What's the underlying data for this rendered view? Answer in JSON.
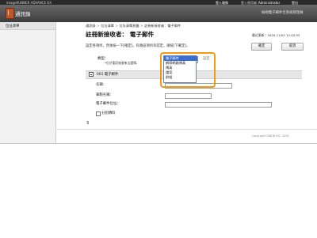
{
  "topbar": {
    "model_text": "imageRUNNER ADVANCE DX",
    "service_button": "登入服務",
    "user_label": "登入使用者：",
    "user_name": "Administrator",
    "logout_button": "登出"
  },
  "header": {
    "app_title": "通訊錄",
    "right_link": "檢視電子郵件至系統管理員"
  },
  "sidebar": {
    "items": [
      {
        "label": "位址清單"
      }
    ]
  },
  "breadcrumb": {
    "items": [
      "通訊錄",
      "位址清單",
      "位址清單頁籤",
      "註冊新接收者：電子郵件"
    ],
    "separator": ">"
  },
  "page": {
    "title": "註冊新接收者： 電子郵件",
    "last_updated": "最近更新：2020 11/02 12:03:55",
    "instructions": "設定各項目，然後按一下[確定]。有頭皮項目幸認定，請按[下確定]。",
    "ok_label": "確定",
    "cancel_label": "取消"
  },
  "type_row": {
    "label": "類型：",
    "note": "*位於重設後會無法選擇。",
    "selected": "電子郵件",
    "settings_link": "設定",
    "options": [
      "電子郵件",
      "網際網路傳真",
      "傳真",
      "檔案",
      "群組"
    ]
  },
  "section": {
    "title": "001 電子郵件",
    "fields": [
      {
        "label": "名稱：",
        "value": ""
      },
      {
        "label": "筆劃名稱：",
        "value": ""
      },
      {
        "label": "電子郵件位址：",
        "value": ""
      }
    ],
    "checkbox_label": "分割傳料",
    "checkbox_checked": false
  },
  "footer": {
    "copyright": "Copyright CANON INC. 2020"
  },
  "colors": {
    "highlight": "#f29a14",
    "selected_option": "#3b6bd6",
    "header_dark": "#3c3c3c",
    "book_icon": "#c0562c"
  }
}
